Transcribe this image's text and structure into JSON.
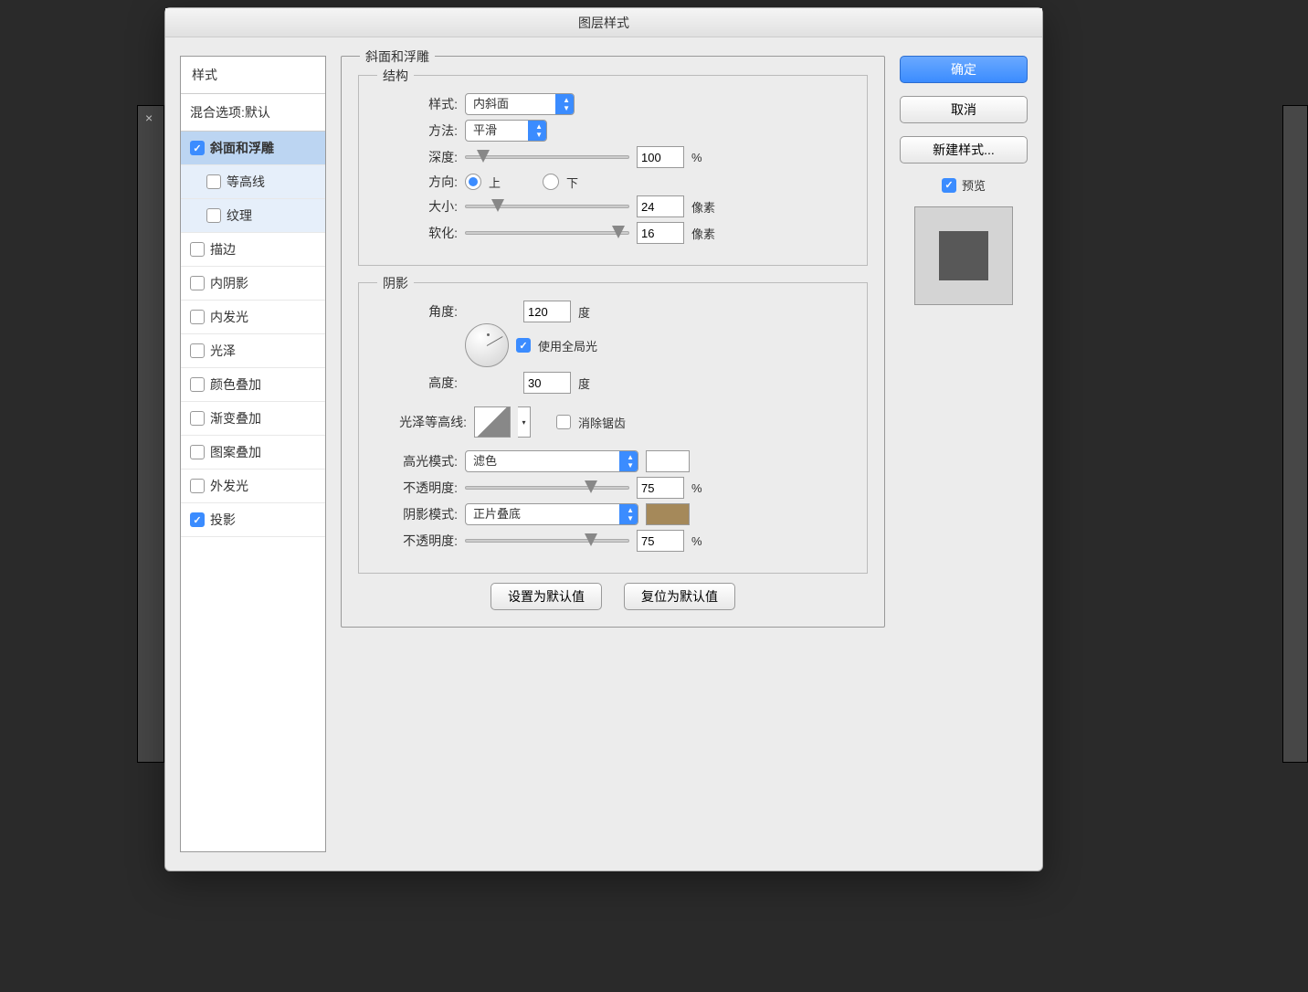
{
  "dialog": {
    "title": "图层样式"
  },
  "sidebar": {
    "header": "样式",
    "subheader": "混合选项:默认",
    "items": [
      {
        "label": "斜面和浮雕",
        "checked": true,
        "selected": true
      },
      {
        "label": "等高线",
        "checked": false,
        "sub": true
      },
      {
        "label": "纹理",
        "checked": false,
        "sub": true
      },
      {
        "label": "描边",
        "checked": false
      },
      {
        "label": "内阴影",
        "checked": false
      },
      {
        "label": "内发光",
        "checked": false
      },
      {
        "label": "光泽",
        "checked": false
      },
      {
        "label": "颜色叠加",
        "checked": false
      },
      {
        "label": "渐变叠加",
        "checked": false
      },
      {
        "label": "图案叠加",
        "checked": false
      },
      {
        "label": "外发光",
        "checked": false
      },
      {
        "label": "投影",
        "checked": true
      }
    ]
  },
  "panel": {
    "title": "斜面和浮雕",
    "structure": {
      "legend": "结构",
      "style_label": "样式:",
      "style_value": "内斜面",
      "method_label": "方法:",
      "method_value": "平滑",
      "depth_label": "深度:",
      "depth_value": "100",
      "depth_unit": "%",
      "direction_label": "方向:",
      "direction_up": "上",
      "direction_down": "下",
      "size_label": "大小:",
      "size_value": "24",
      "size_unit": "像素",
      "soften_label": "软化:",
      "soften_value": "16",
      "soften_unit": "像素"
    },
    "shadow": {
      "legend": "阴影",
      "angle_label": "角度:",
      "angle_value": "120",
      "angle_unit": "度",
      "global_light_label": "使用全局光",
      "altitude_label": "高度:",
      "altitude_value": "30",
      "altitude_unit": "度",
      "gloss_contour_label": "光泽等高线:",
      "antialias_label": "消除锯齿",
      "highlight_mode_label": "高光模式:",
      "highlight_mode_value": "滤色",
      "highlight_opacity_label": "不透明度:",
      "highlight_opacity_value": "75",
      "highlight_opacity_unit": "%",
      "shadow_mode_label": "阴影模式:",
      "shadow_mode_value": "正片叠底",
      "shadow_opacity_label": "不透明度:",
      "shadow_opacity_value": "75",
      "shadow_opacity_unit": "%",
      "shadow_color": "#a5895a",
      "highlight_color": "#ffffff"
    },
    "defaults": {
      "set": "设置为默认值",
      "reset": "复位为默认值"
    }
  },
  "buttons": {
    "ok": "确定",
    "cancel": "取消",
    "new_style": "新建样式...",
    "preview": "预览"
  }
}
